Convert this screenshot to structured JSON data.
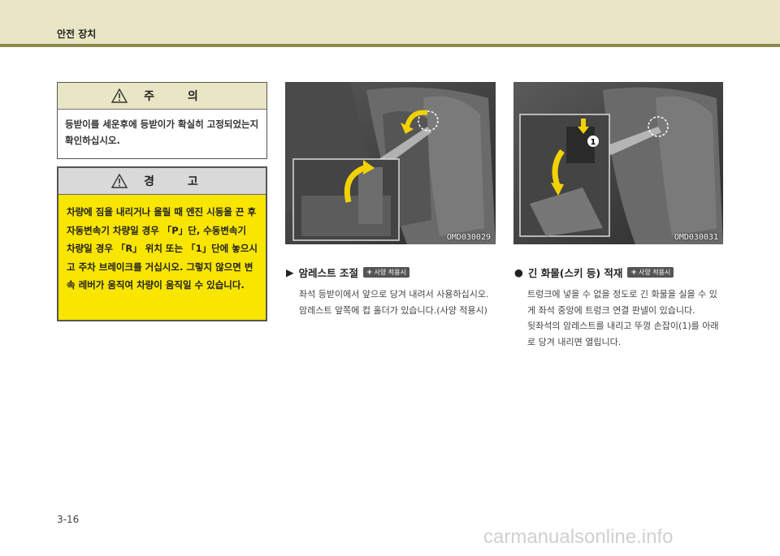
{
  "header": {
    "title": "안전 장치"
  },
  "caution": {
    "title": "주 의",
    "body": "등받이를 세운후에 등받이가 확실히 고정되었는지 확인하십시오."
  },
  "warning": {
    "title": "경 고",
    "body": "차량에 짐을 내리거나 올릴 때 엔진 시동을 끈 후 자동변속기 차량일 경우 「P」단, 수동변속기 차량일 경우 「R」 위치 또는 「1」단에 놓으시고 주차 브레이크를 거십시오. 그렇지 않으면 변속 레버가 움직여 차량이 움직일 수 있습니다."
  },
  "images": [
    {
      "code": "OMD030029"
    },
    {
      "code": "OMD030031",
      "callout": "1"
    }
  ],
  "sections": [
    {
      "bullet": "▶",
      "title": "암레스트 조절",
      "badge": "사양 적용시",
      "paragraphs": [
        "좌석 등받이에서 앞으로 당겨 내려서 사용하십시오.",
        "암레스트 앞쪽에 컵 홀더가 있습니다.(사양 적용시)"
      ]
    },
    {
      "bullet": "●",
      "title": "긴 화물(스키 등) 적재",
      "badge": "사양 적용시",
      "paragraphs": [
        "트렁크에 넣을 수 없을 정도로 긴 화물을 실을 수 있게 좌석 중앙에 트렁크 연결 판넬이 있습니다.",
        "뒷좌석의 암레스트를 내리고 뚜껑 손잡이(1)를 아래로 당겨 내리면 열립니다."
      ]
    }
  ],
  "page_number": "3-16",
  "watermark": "carmanualsonline.info",
  "colors": {
    "header_bg": "#e8e6c4",
    "header_bar": "#8f8a4a",
    "warning_bg": "#f8e500",
    "arrow": "#f2d200"
  }
}
